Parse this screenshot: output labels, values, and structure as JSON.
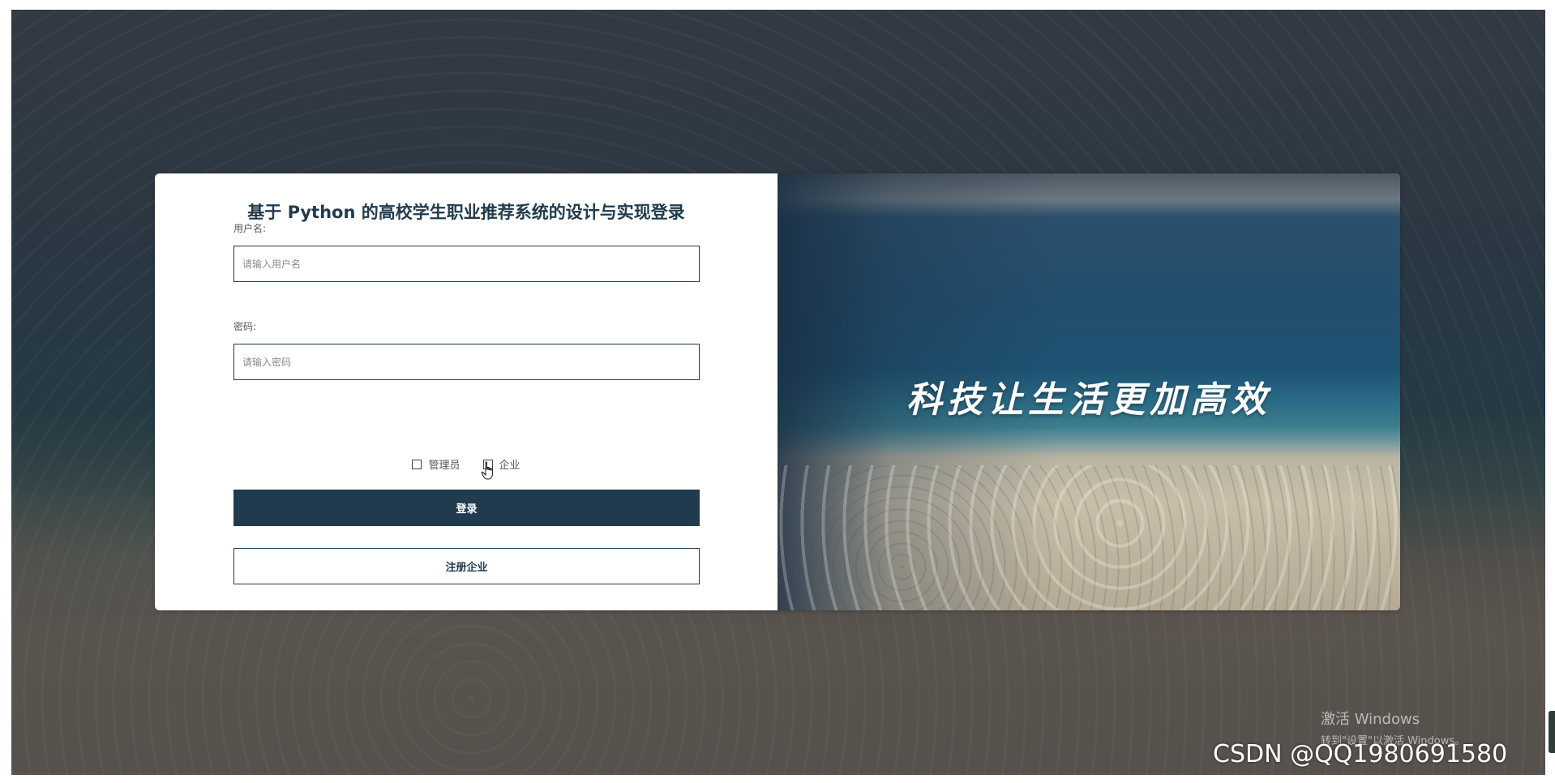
{
  "login": {
    "title": "基于 Python 的高校学生职业推荐系统的设计与实现登录",
    "username_label": "用户名:",
    "username_placeholder": "请输入用户名",
    "password_label": "密码:",
    "password_placeholder": "请输入密码",
    "roles": [
      "管理员",
      "企业"
    ],
    "login_button": "登录",
    "register_button": "注册企业"
  },
  "banner": {
    "slogan": "科技让生活更加高效"
  },
  "overlay": {
    "activate_title": "激活 Windows",
    "activate_hint": "转到\"设置\"以激活 Windows。",
    "csdn_watermark": "CSDN @QQ1980691580"
  },
  "colors": {
    "primary": "#213b4e",
    "text_muted": "#555555"
  },
  "icons": {
    "cursor": "hand-pointer-icon"
  }
}
